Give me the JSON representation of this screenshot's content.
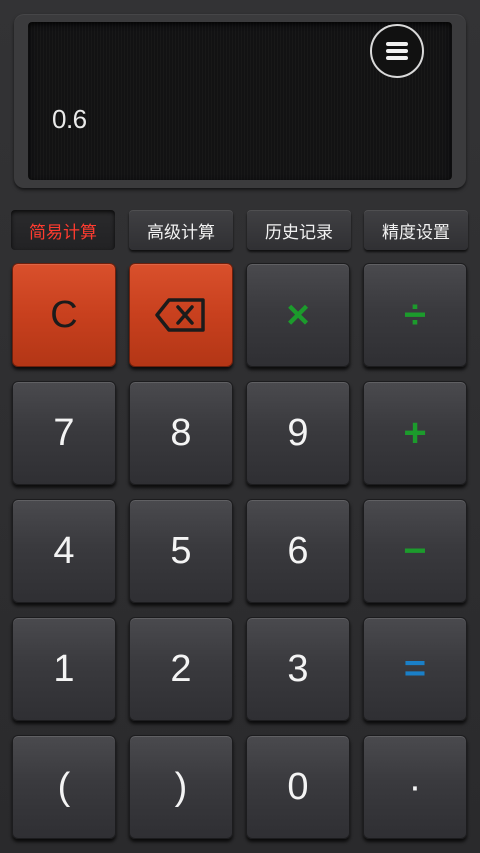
{
  "display": {
    "value": "0.6",
    "menu_icon": "hamburger-menu-icon"
  },
  "tabs": [
    {
      "label": "简易计算",
      "active": true
    },
    {
      "label": "高级计算",
      "active": false
    },
    {
      "label": "历史记录",
      "active": false
    },
    {
      "label": "精度设置",
      "active": false
    }
  ],
  "keys": {
    "clear": "C",
    "backspace_icon": "backspace-icon",
    "multiply": "×",
    "divide": "÷",
    "seven": "7",
    "eight": "8",
    "nine": "9",
    "plus": "+",
    "four": "4",
    "five": "5",
    "six": "6",
    "minus": "−",
    "one": "1",
    "two": "2",
    "three": "3",
    "equals": "=",
    "open_paren": "(",
    "close_paren": ")",
    "zero": "0",
    "decimal": "·"
  },
  "colors": {
    "accent_red": "#c8401e",
    "active_tab_text": "#ff3b2f",
    "operator_green": "#1c9b2c",
    "equals_blue": "#1a7fc7"
  }
}
